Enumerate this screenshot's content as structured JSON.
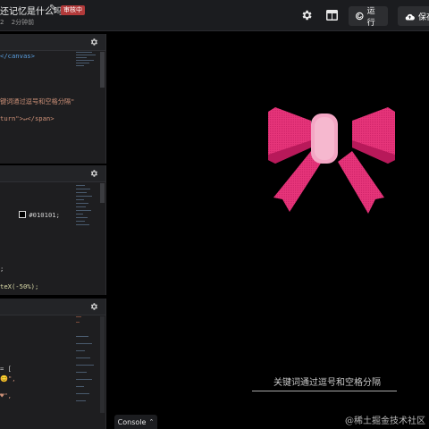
{
  "header": {
    "title": "还记忆是什么吗?",
    "badge": "审核中",
    "subtitle_count": "2",
    "subtitle_time": "2分钟前",
    "run_label": "运行",
    "save_label": "保存"
  },
  "panels": {
    "html_lines": [
      "</canvas>",
      "键词通过逗号和空格分隔\"",
      "turn\">↵</span>"
    ],
    "css_lines": [
      "#010101;",
      ";",
      "teX(-50%);"
    ],
    "js_lines": [
      "= [",
      "😊\",",
      "♥\","
    ]
  },
  "preview": {
    "caption": "关键词通过逗号和空格分隔",
    "console_label": "Console",
    "watermark": "@稀土掘金技术社区",
    "bow_color": "#e6357a",
    "bow_dark": "#b8195a",
    "knot_color": "#f3a6c4"
  }
}
